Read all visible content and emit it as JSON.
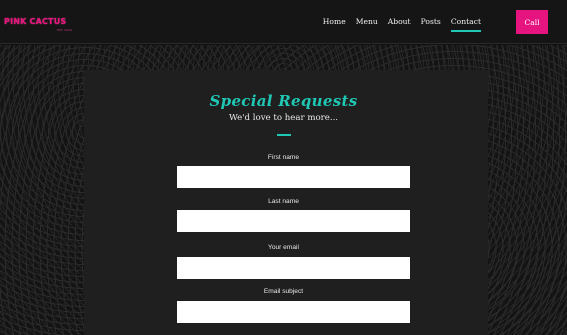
{
  "header": {
    "logo_text": "PINK CACTUS",
    "logo_sub": "EST. 2024",
    "nav": [
      "Home",
      "Menu",
      "About",
      "Posts",
      "Contact"
    ],
    "active_nav": "Contact",
    "call_label": "Call"
  },
  "form": {
    "title": "Special Requests",
    "subtitle": "We'd love to hear more...",
    "fields": [
      {
        "label": "First name",
        "value": ""
      },
      {
        "label": "Last name",
        "value": ""
      },
      {
        "label": "Your email",
        "value": ""
      },
      {
        "label": "Email subject",
        "value": ""
      }
    ]
  },
  "colors": {
    "accent": "#1fc8b5",
    "brand": "#e6147f",
    "panel": "#1f1f1f",
    "header": "#151515"
  }
}
